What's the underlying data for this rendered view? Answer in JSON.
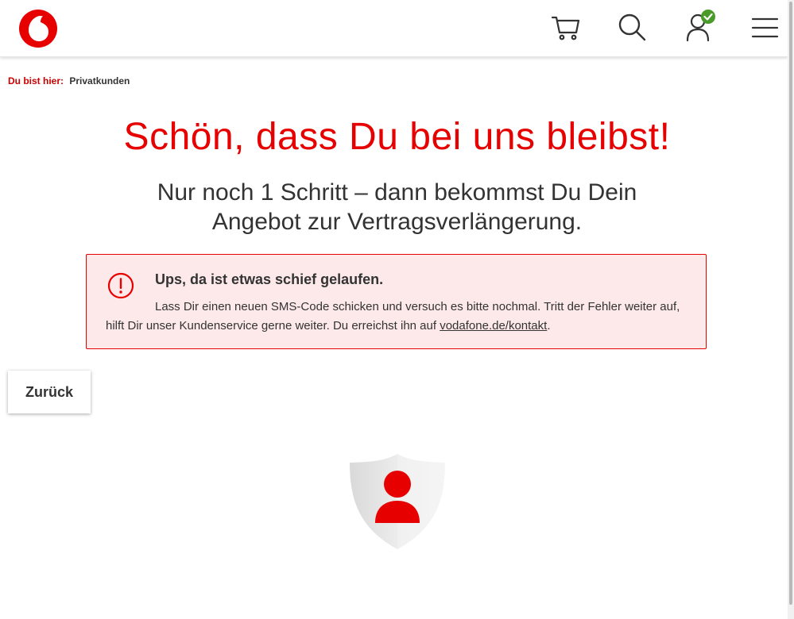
{
  "header": {
    "logo_icon": "vodafone-logo",
    "icons": [
      "cart-icon",
      "search-icon",
      "user-verified-icon",
      "menu-icon"
    ],
    "user_badge_color": "#4a9a2a"
  },
  "breadcrumb": {
    "label": "Du bist hier:",
    "current": "Privatkunden"
  },
  "main": {
    "headline": "Schön, dass Du bei uns bleibst!",
    "subheadline": "Nur noch 1 Schritt – dann bekommst Du Dein Angebot zur Vertragsverlängerung."
  },
  "alert": {
    "icon": "error-exclamation-icon",
    "title": "Ups, da ist etwas schief gelaufen.",
    "body": "Lass Dir einen neuen SMS-Code schicken und versuch es bitte nochmal. Tritt der Fehler weiter auf, hilft Dir unser Kundenservice gerne weiter. Du erreichst ihn auf ",
    "link_text": "vodafone.de/kontakt",
    "body_end": "."
  },
  "actions": {
    "back_label": "Zurück"
  },
  "illustration": {
    "icon": "security-shield-user-icon"
  },
  "colors": {
    "brand_red": "#e60000",
    "alert_background": "#fde9ea",
    "text": "#333333"
  }
}
